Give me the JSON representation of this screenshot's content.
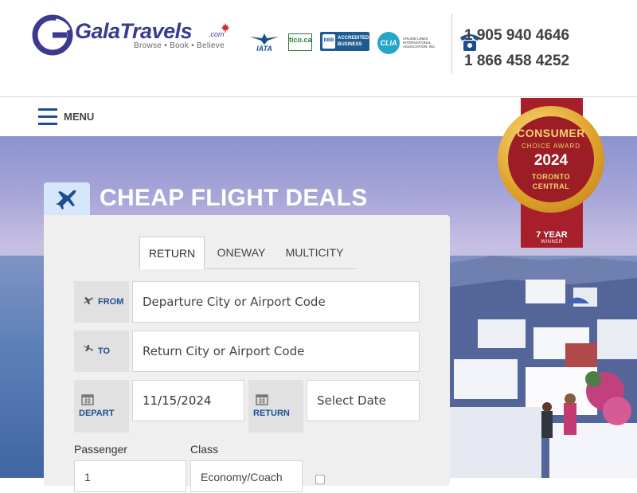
{
  "brand": {
    "name": "GalaTravels",
    "dotcom": ".com",
    "tagline": "Browse • Book • Believe",
    "primary_color": "#3b3a8f",
    "accent_color": "#1e4e91"
  },
  "accreditations": {
    "iata": "IATA",
    "tico": "tico.ca",
    "bbb_mark": "BBB",
    "bbb": "ACCREDITED BUSINESS",
    "clia_mark": "CLIA",
    "clia": "CRUISE LINES INTERNATIONAL ASSOCIATION, INC"
  },
  "contact": {
    "phone_1": "1 905 940 4646",
    "phone_2": "1 866 458 4252",
    "icon": "phone-icon"
  },
  "nav": {
    "menu_label": "MENU",
    "menu_icon": "hamburger-icon"
  },
  "award": {
    "line1": "CONSUMER",
    "line2": "CHOICE AWARD",
    "year": "2024",
    "city1": "TORONTO",
    "city2": "CENTRAL",
    "years": "7 YEAR",
    "winner": "WINNER"
  },
  "search": {
    "title": "CHEAP FLIGHT DEALS",
    "section_icon": "airplane-icon",
    "tabs": [
      {
        "label": "RETURN",
        "active": true
      },
      {
        "label": "ONEWAY",
        "active": false
      },
      {
        "label": "MULTICITY",
        "active": false
      }
    ],
    "from": {
      "label": "FROM",
      "placeholder": "Departure City or Airport Code",
      "icon": "plane-takeoff-icon"
    },
    "to": {
      "label": "TO",
      "placeholder": "Return City or Airport Code",
      "icon": "plane-landing-icon"
    },
    "depart": {
      "label": "DEPART",
      "value": "11/15/2024",
      "icon": "calendar-icon"
    },
    "return": {
      "label": "RETURN",
      "placeholder": "Select Date",
      "icon": "calendar-icon"
    },
    "passenger": {
      "label": "Passenger",
      "value": "1"
    },
    "class": {
      "label": "Class",
      "value": "Economy/Coach"
    }
  }
}
